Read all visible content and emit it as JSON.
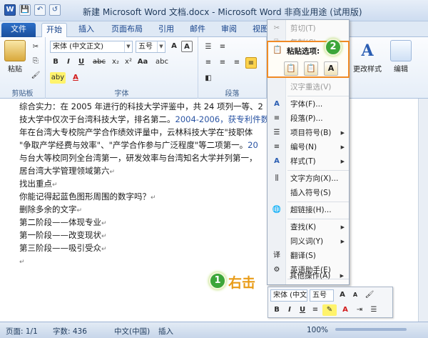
{
  "window": {
    "title": "新建 Microsoft Word 文档.docx - Microsoft Word 非商业用途 (试用版)"
  },
  "qat": {
    "app_icon": "W",
    "save": "💾",
    "undo": "↶",
    "redo": "↺"
  },
  "tabs": [
    "文件",
    "开始",
    "插入",
    "页面布局",
    "引用",
    "邮件",
    "审阅",
    "视图"
  ],
  "ribbon": {
    "clipboard": {
      "paste": "粘贴",
      "label": "剪贴板"
    },
    "font": {
      "name": "宋体 (中文正文)",
      "size": "五号",
      "label": "字体",
      "bold": "B",
      "italic": "I",
      "underline": "U",
      "strike": "abc",
      "sub": "x₂",
      "sup": "x²",
      "fontcolor": "A",
      "grow": "A",
      "textcase": "Aa",
      "abc": "abc",
      "highlight": "aby"
    },
    "paragraph": {
      "label": "段落"
    },
    "styles": {
      "change": "更改样式"
    },
    "editing": {
      "label": "编辑"
    }
  },
  "document": {
    "lines": [
      {
        "text": "综合实力：在 2005 年进行的科技大学评鉴中，共 24 项列一等、2",
        "tail": ""
      },
      {
        "text": "技大学中仅次于台湾科技大学，排名第二。",
        "blue": "2004-2006，获专利件数",
        "tail": ""
      },
      {
        "text": "年在台湾大专校院产学合作绩效评量中，云林科技大学在\"技职体",
        "tail": ""
      },
      {
        "text": "\"争取产学经费与效率\"、\"产学合作参与广泛程度\"等二项第一。",
        "blue": "20",
        "tail": ""
      },
      {
        "text": "与台大等校同列全台湾第一，研发效率与台湾知名大学并列第一，",
        "tail": ""
      },
      {
        "text": "居台湾大学管理领域第六",
        "tail": "↵"
      },
      {
        "text": "找出重点",
        "tail": "↵"
      },
      {
        "text": "你能记得起蓝色图形周围的数字吗？",
        "tail": "↵"
      },
      {
        "text": "删除多余的文字",
        "tail": "↵"
      },
      {
        "text": "第二阶段——体现专业",
        "tail": "↵"
      },
      {
        "text": "第一阶段——改变现状",
        "tail": "↵"
      },
      {
        "text": "第三阶段——吸引受众",
        "tail": "↵"
      },
      {
        "text": "",
        "tail": "↵"
      }
    ]
  },
  "context_menu": {
    "cut": "剪切(T)",
    "copy": "复制(C)",
    "paste_options": "粘贴选项:",
    "paste_buttons": [
      "📋",
      "📋",
      "A"
    ],
    "items": [
      {
        "label": "汉字重选(V)",
        "disabled": true,
        "arrow": false
      },
      {
        "label": "字体(F)...",
        "disabled": false,
        "arrow": false
      },
      {
        "label": "段落(P)...",
        "disabled": false,
        "arrow": false
      },
      {
        "label": "项目符号(B)",
        "disabled": false,
        "arrow": true
      },
      {
        "label": "编号(N)",
        "disabled": false,
        "arrow": true
      },
      {
        "label": "样式(T)",
        "disabled": false,
        "arrow": true
      },
      {
        "label": "文字方向(X)...",
        "disabled": false,
        "arrow": false
      },
      {
        "label": "插入符号(S)",
        "disabled": false,
        "arrow": false
      },
      {
        "label": "超链接(H)...",
        "disabled": false,
        "arrow": false
      },
      {
        "label": "查找(K)",
        "disabled": false,
        "arrow": true
      },
      {
        "label": "同义词(Y)",
        "disabled": false,
        "arrow": true
      },
      {
        "label": "翻译(S)",
        "disabled": false,
        "arrow": false
      },
      {
        "label": "英语助手(E)",
        "disabled": false,
        "arrow": false
      },
      {
        "label": "其他操作(A)",
        "disabled": false,
        "arrow": true
      }
    ]
  },
  "mini_toolbar": {
    "font": "宋体 (中文",
    "size": "五号"
  },
  "annotations": {
    "badge1": "1",
    "badge2": "2",
    "right_click": "右击"
  },
  "status": {
    "page": "页面: 1/1",
    "words": "字数: 436",
    "lang": "中文(中国)",
    "mode": "插入",
    "zoom": "100%"
  },
  "colors": {
    "accent_orange": "#f08a24",
    "badge_green": "#3ca63a",
    "file_tab": "#1a4f9d"
  }
}
